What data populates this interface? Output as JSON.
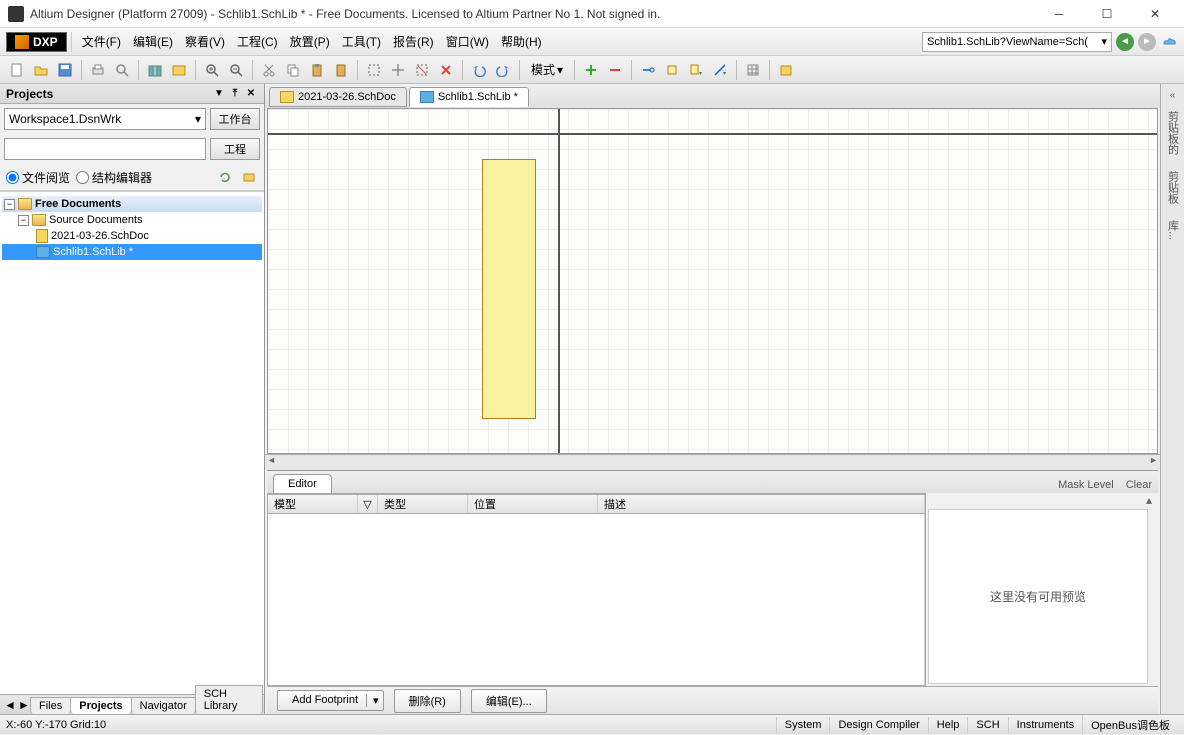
{
  "title": "Altium Designer (Platform 27009) - Schlib1.SchLib * - Free Documents. Licensed to Altium Partner No 1. Not signed in.",
  "dxp_label": "DXP",
  "menus": [
    "文件(F)",
    "编辑(E)",
    "察看(V)",
    "工程(C)",
    "放置(P)",
    "工具(T)",
    "报告(R)",
    "窗口(W)",
    "帮助(H)"
  ],
  "address": "Schlib1.SchLib?ViewName=Sch(",
  "toolbar_mode": "模式",
  "projects": {
    "title": "Projects",
    "workspace": "Workspace1.DsnWrk",
    "btn_workspace": "工作台",
    "btn_project": "工程",
    "radio_file": "文件阅览",
    "radio_struct": "结构编辑器",
    "tree": {
      "root": "Free Documents",
      "folder": "Source Documents",
      "doc1": "2021-03-26.SchDoc",
      "doc2": "Schlib1.SchLib *"
    },
    "tabs": [
      "Files",
      "Projects",
      "Navigator",
      "SCH Library"
    ]
  },
  "doc_tabs": [
    {
      "label": "2021-03-26.SchDoc",
      "active": false
    },
    {
      "label": "Schlib1.SchLib *",
      "active": true
    }
  ],
  "editor": {
    "tab": "Editor",
    "mask": "Mask Level",
    "clear": "Clear",
    "cols": {
      "model": "模型",
      "type": "类型",
      "pos": "位置",
      "desc": "描述"
    },
    "preview_empty": "这里没有可用预览",
    "add_footprint": "Add Footprint",
    "delete": "删除(R)",
    "edit": "编辑(E)..."
  },
  "right_tabs": [
    "剪贴板的",
    "剪贴板",
    "库..."
  ],
  "status": {
    "coords": "X:-60 Y:-170  Grid:10",
    "buttons": [
      "System",
      "Design Compiler",
      "Help",
      "SCH",
      "Instruments",
      "OpenBus调色板"
    ]
  }
}
